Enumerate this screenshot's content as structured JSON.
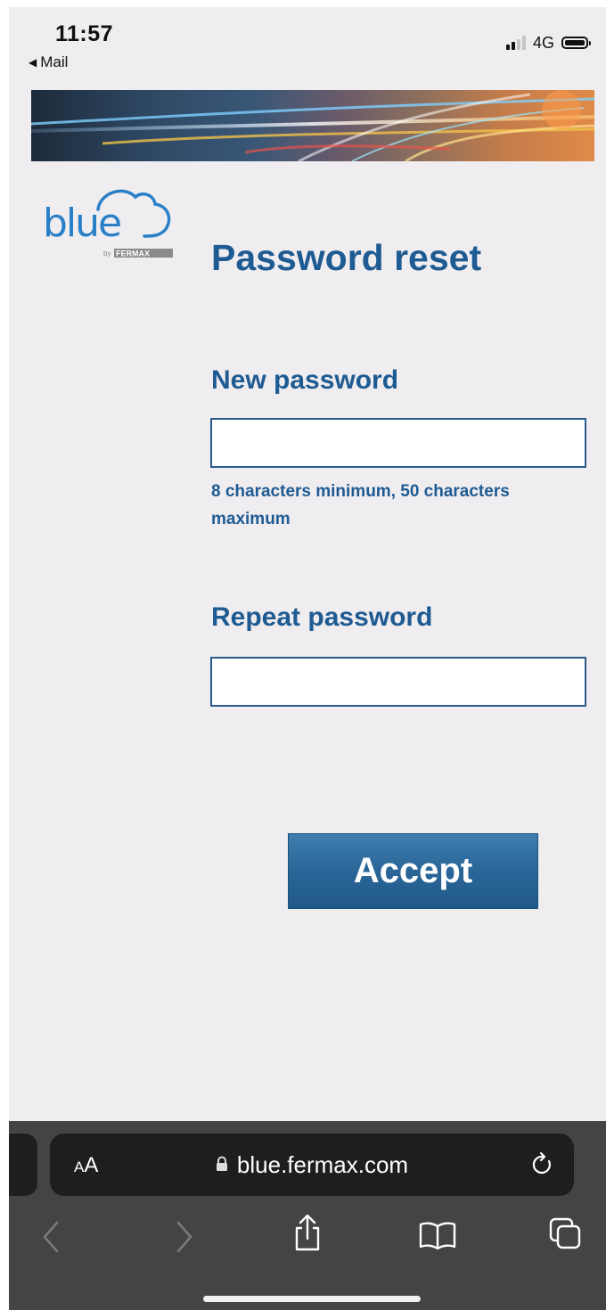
{
  "status_bar": {
    "time": "11:57",
    "back_label": "Mail",
    "network": "4G"
  },
  "logo": {
    "text": "blue",
    "by_label": "by",
    "brand": "FERMAX"
  },
  "page": {
    "title": "Password reset",
    "new_password_label": "New password",
    "new_password_value": "",
    "password_hint": "8 characters minimum, 50 characters maximum",
    "repeat_password_label": "Repeat password",
    "repeat_password_value": "",
    "accept_label": "Accept"
  },
  "browser": {
    "text_size_small": "A",
    "text_size_large": "A",
    "url": "blue.fermax.com",
    "icons": [
      "lock-icon",
      "reload-icon",
      "back-icon",
      "forward-icon",
      "share-icon",
      "bookmarks-icon",
      "tabs-icon"
    ]
  },
  "colors": {
    "accent": "#1f5b93",
    "background": "#efedef",
    "button": "#2a6698",
    "toolbar": "#444446"
  }
}
